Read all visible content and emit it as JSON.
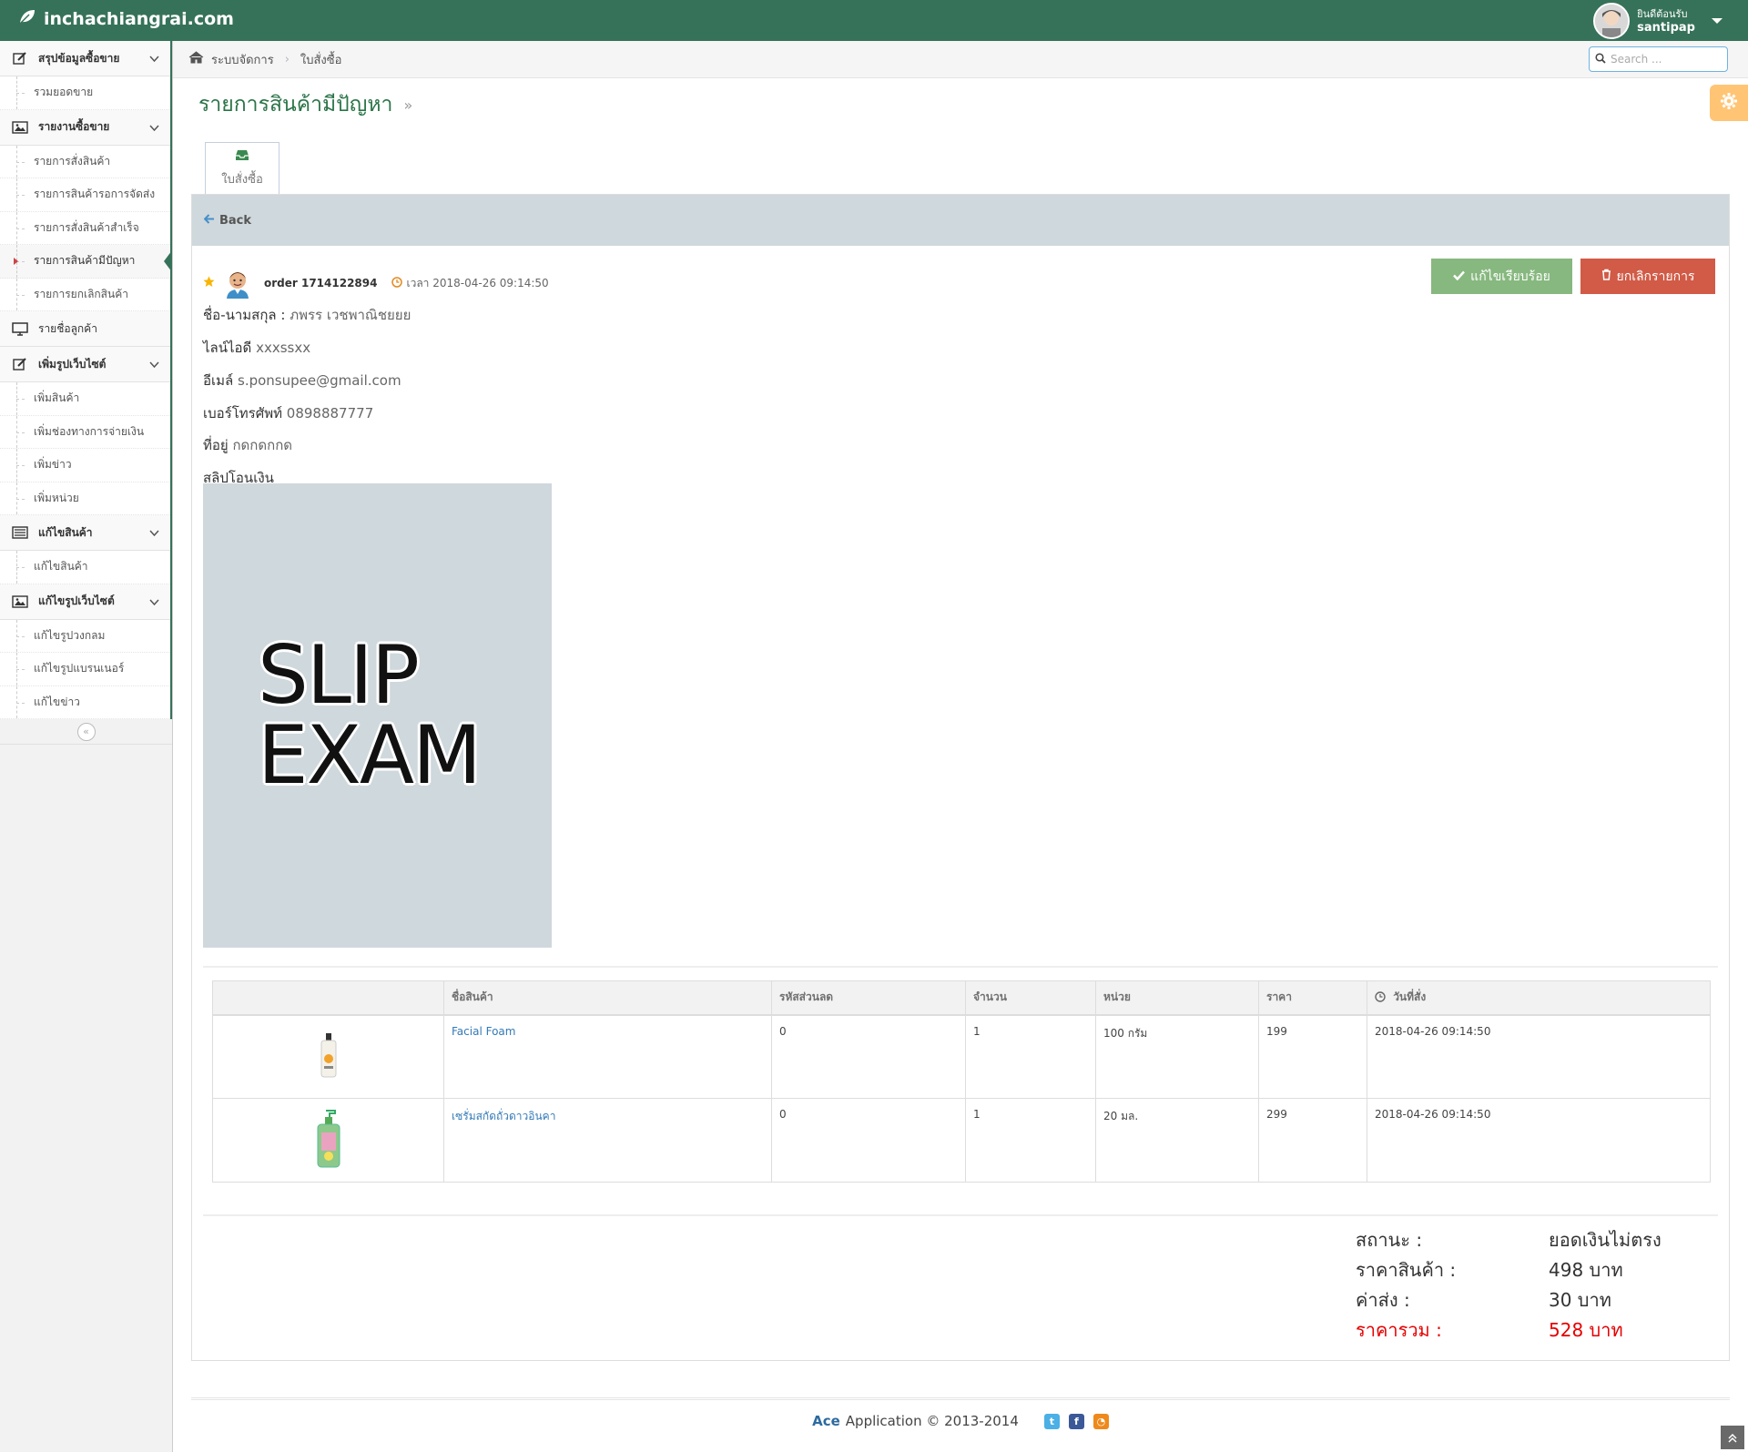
{
  "navbar": {
    "brand": "inchachiangrai.com",
    "welcome": "ยินดีต้อนรับ",
    "username": "santipap"
  },
  "sidebar": {
    "groups": [
      {
        "label": "สรุปข้อมูลซื้อขาย",
        "icon": "edit-icon",
        "items": [
          "รวมยอดขาย"
        ]
      },
      {
        "label": "รายงานซื้อขาย",
        "icon": "picture-icon",
        "items": [
          "รายการสั่งสินค้า",
          "รายการสินค้ารอการจัดส่ง",
          "รายการสั่งสินค้าสำเร็จ",
          "รายการสินค้ามีปัญหา",
          "รายการยกเลิกสินค้า"
        ]
      },
      {
        "label": "รายชื่อลูกค้า",
        "icon": "desktop-icon",
        "items": []
      },
      {
        "label": "เพิ่มรูปเว็บไซต์",
        "icon": "edit-icon",
        "items": [
          "เพิ่มสินค้า",
          "เพิ่มช่องทางการจ่ายเงิน",
          "เพิ่มข่าว",
          "เพิ่มหน่วย"
        ]
      },
      {
        "label": "แก้ไขสินค้า",
        "icon": "list-icon",
        "items": [
          "แก้ไขสินค้า"
        ]
      },
      {
        "label": "แก้ไขรูปเว็บไซต์",
        "icon": "picture-icon",
        "items": [
          "แก้ไขรูปวงกลม",
          "แก้ไขรูปแบรนเนอร์",
          "แก้ไขข่าว"
        ]
      }
    ]
  },
  "breadcrumbs": {
    "home": "ระบบจัดการ",
    "current": "ใบสั่งซื้อ"
  },
  "search": {
    "placeholder": "Search ..."
  },
  "page": {
    "title": "รายการสินค้ามีปัญหา",
    "tab": "ใบสั่งซื้อ",
    "back": "Back"
  },
  "order": {
    "id_label": "order 1714122894",
    "time_label": "เวลา 2018-04-26 09:14:50",
    "btn_ok": "แก้ไขเรียบร้อย",
    "btn_cancel": "ยกเลิกรายการ",
    "name_label": "ชื่อ-นามสกุล :",
    "name": "ภพรร เวชพาณิชยยย",
    "line_label": "ไลน์ไอดี",
    "line": "xxxssxx",
    "email_label": "อีเมล์",
    "email": "s.ponsupee@gmail.com",
    "phone_label": "เบอร์โทรศัพท์",
    "phone": "0898887777",
    "address_label": "ที่อยู่",
    "address": "กดกดกกด",
    "slip_label": "สลิปโอนเงิน",
    "slip_text_1": "SLIP",
    "slip_text_2": "EXAM"
  },
  "table": {
    "headers": [
      "",
      "ชื่อสินค้า",
      "รหัสส่วนลด",
      "จำนวน",
      "หน่วย",
      "ราคา",
      "วันที่สั่ง"
    ],
    "rows": [
      {
        "name": "Facial Foam",
        "discount": "0",
        "qty": "1",
        "unit": "100 กรัม",
        "price": "199",
        "date": "2018-04-26 09:14:50"
      },
      {
        "name": "เซรั่มสกัดถั่วดาวอินคา",
        "discount": "0",
        "qty": "1",
        "unit": "20 มล.",
        "price": "299",
        "date": "2018-04-26 09:14:50"
      }
    ]
  },
  "summary": {
    "status_label": "สถานะ :",
    "status": "ยอดเงินไม่ตรง",
    "goods_label": "ราคาสินค้า :",
    "goods": "498 บาท",
    "shipping_label": "ค่าส่ง :",
    "shipping": "30 บาท",
    "total_label": "ราคารวม :",
    "total": "528 บาท"
  },
  "footer": {
    "ace": "Ace",
    "text": "Application © 2013-2014"
  },
  "colors": {
    "navbar": "#367259",
    "title": "#2b7448",
    "ok": "#87b87f",
    "cancel": "#d15b47",
    "total": "#e60000"
  }
}
